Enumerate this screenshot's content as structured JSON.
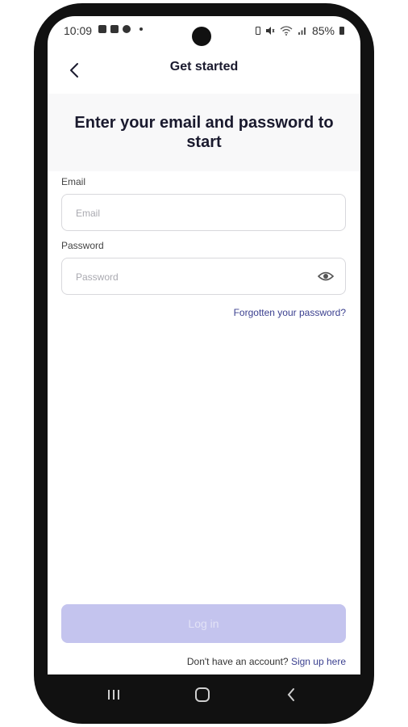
{
  "status_bar": {
    "time": "10:09",
    "battery": "85%",
    "left_icons": [
      "gallery-icon",
      "checkbox-icon",
      "messenger-icon"
    ],
    "right_icons": [
      "battery-saver-icon",
      "mute-icon",
      "wifi-icon",
      "signal-icon",
      "battery-icon"
    ]
  },
  "header": {
    "back_icon": "chevron-left-icon",
    "title": "Get started"
  },
  "hero": {
    "title": "Enter your email and password to start"
  },
  "form": {
    "email": {
      "label": "Email",
      "placeholder": "Email",
      "value": ""
    },
    "password": {
      "label": "Password",
      "placeholder": "Password",
      "value": "",
      "toggle_icon": "eye-icon"
    },
    "forgot_link": "Forgotten your password?"
  },
  "actions": {
    "login_label": "Log in",
    "login_enabled": false,
    "signup_prompt": "Don't have an account?",
    "signup_link": "Sign up here"
  },
  "nav_bar": {
    "icons": [
      "recent-apps-icon",
      "home-icon",
      "back-icon"
    ]
  },
  "colors": {
    "accent": "#3a3f8f",
    "button_disabled_bg": "#c4c4ee",
    "hero_bg": "#f8f8f9",
    "frame": "#111111"
  }
}
